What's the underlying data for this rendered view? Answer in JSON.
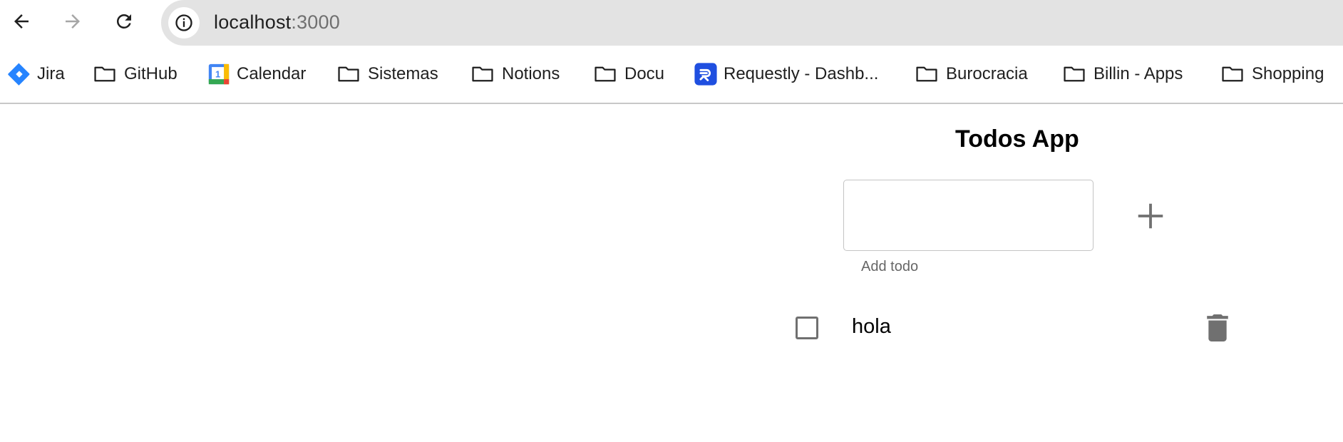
{
  "browser": {
    "url_host": "localhost",
    "url_port": ":3000",
    "back_icon": "arrow-back-icon",
    "forward_icon": "arrow-forward-icon",
    "reload_icon": "reload-icon",
    "site_info_icon": "info-icon"
  },
  "bookmarks": [
    {
      "label": "Jira",
      "icon": "jira-icon"
    },
    {
      "label": "GitHub",
      "icon": "folder-icon"
    },
    {
      "label": "Calendar",
      "icon": "calendar-icon"
    },
    {
      "label": "Sistemas",
      "icon": "folder-icon"
    },
    {
      "label": "Notions",
      "icon": "folder-icon"
    },
    {
      "label": "Docu",
      "icon": "folder-icon"
    },
    {
      "label": "Requestly - Dashb...",
      "icon": "requestly-icon"
    },
    {
      "label": "Burocracia",
      "icon": "folder-icon"
    },
    {
      "label": "Billin - Apps",
      "icon": "folder-icon"
    },
    {
      "label": "Shopping",
      "icon": "folder-icon"
    }
  ],
  "app": {
    "title": "Todos App",
    "input_value": "",
    "helper_text": "Add todo",
    "add_icon": "plus-icon",
    "todos": [
      {
        "text": "hola",
        "checked": false
      }
    ]
  },
  "colors": {
    "omnibox_bg": "#e3e3e3",
    "icon_gray": "#707070",
    "jira_blue": "#2684ff",
    "requestly_blue": "#1f4fe0"
  }
}
